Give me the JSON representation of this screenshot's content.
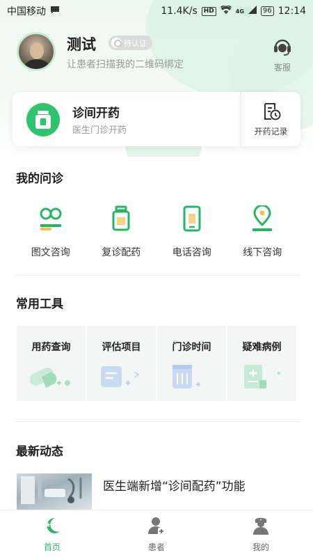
{
  "status_bar": {
    "carrier": "中国移动",
    "net_speed": "11.4K/s",
    "hd_badge": "HD",
    "signal_label": "4G",
    "battery": "96",
    "time": "12:14"
  },
  "profile": {
    "name": "测试",
    "verify_status": "待认证",
    "subtitle": "让患者扫描我的二维码绑定",
    "service_label": "客服"
  },
  "clinic_card": {
    "title": "诊间开药",
    "subtitle": "医生门诊开药",
    "record_label": "开药记录"
  },
  "consult": {
    "title": "我的问诊",
    "items": [
      {
        "label": "图文咨询",
        "icon": "chat-icon"
      },
      {
        "label": "复诊配药",
        "icon": "medicine-bottle-icon"
      },
      {
        "label": "电话咨询",
        "icon": "phone-icon"
      },
      {
        "label": "线下咨询",
        "icon": "location-pin-icon"
      }
    ]
  },
  "tools": {
    "title": "常用工具",
    "items": [
      {
        "label": "用药查询",
        "icon": "pill-icon"
      },
      {
        "label": "评估项目",
        "icon": "assessment-icon"
      },
      {
        "label": "门诊时间",
        "icon": "calendar-icon"
      },
      {
        "label": "疑难病例",
        "icon": "case-icon"
      }
    ]
  },
  "news": {
    "title": "最新动态",
    "items": [
      {
        "title": "医生端新增“诊间配药”功能"
      }
    ]
  },
  "tabbar": {
    "items": [
      {
        "label": "首页",
        "active": true
      },
      {
        "label": "患者",
        "active": false
      },
      {
        "label": "我的",
        "active": false
      }
    ]
  },
  "colors": {
    "brand_green": "#2ec36e",
    "tab_active": "#2eb56a",
    "text_muted": "#999999"
  }
}
